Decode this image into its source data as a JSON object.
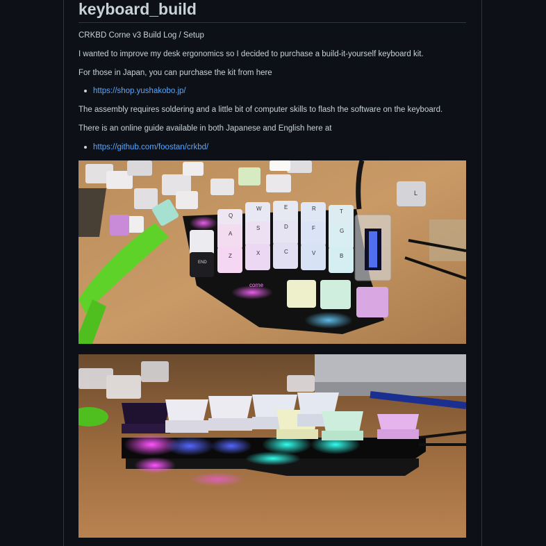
{
  "article": {
    "title": "keyboard_build",
    "subtitle": "CRKBD Corne v3 Build Log / Setup",
    "intro": "I wanted to improve my desk ergonomics so I decided to purchase a build-it-yourself keyboard kit.",
    "japan_note": "For those in Japan, you can purchase the kit from here",
    "shop_link": "https://shop.yushakobo.jp/",
    "assembly_note": "The assembly requires soldering and a little bit of computer skills to flash the software on the keyboard.",
    "guide_note": "There is an online guide available in both Japanese and English here at",
    "guide_link": "https://github.com/foostan/crkbd/"
  },
  "photos": {
    "photo1_keys": [
      "Q",
      "W",
      "E",
      "R",
      "T",
      "A",
      "S",
      "D",
      "F",
      "G",
      "Z",
      "X",
      "C",
      "V",
      "B",
      "END",
      "L"
    ],
    "photo1_brand": "corne"
  },
  "colors": {
    "background": "#0d1117",
    "text": "#c9d1d9",
    "link": "#58a6ff",
    "border": "#30363d"
  }
}
